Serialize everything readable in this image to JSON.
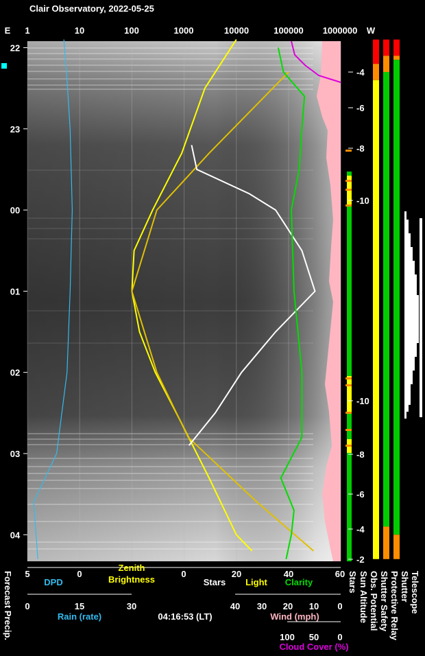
{
  "title": "Clair Observatory, 2022-05-25",
  "timestamp": "04:16:53 (LT)",
  "colors": {
    "background": "#000000",
    "label_white": "#ffffff",
    "dpd": "#33bbee",
    "brightness": "#ffff00",
    "clarity": "#00dd00",
    "wind": "#ffb6c1",
    "cloud": "#dd00dd",
    "red": "#ff0000",
    "orange": "#ff8c00",
    "yellow": "#ffff00",
    "green": "#00cc00",
    "cyan_marker": "#00ffff"
  },
  "top_axis": {
    "left_label": "E",
    "right_label": "W",
    "ticks": [
      "1",
      "10",
      "100",
      "1000",
      "10000",
      "100000",
      "1000000"
    ]
  },
  "time_ticks": [
    "22",
    "23",
    "00",
    "01",
    "02",
    "03",
    "04"
  ],
  "sun_altitude_ticks": [
    "-4",
    "-6",
    "-8",
    "-10",
    "-10",
    "-8",
    "-6",
    "-4",
    "-2"
  ],
  "bottom": {
    "row1_ticks": [
      "5",
      "0",
      "0",
      "20",
      "40",
      "60"
    ],
    "row1_labels": {
      "dpd": "DPD",
      "zenith": "Zenith",
      "brightness": "Brightness",
      "stars": "Stars",
      "light": "Light",
      "clarity": "Clarity"
    },
    "rain_ticks": [
      "0",
      "15",
      "30"
    ],
    "rain_label": "Rain (rate)",
    "wind_ticks": [
      "40",
      "30",
      "20",
      "10",
      "0"
    ],
    "wind_label": "Wind (mph)",
    "cloud_ticks": [
      "100",
      "50",
      "0"
    ],
    "cloud_label": "Cloud Cover (%)"
  },
  "vertical_labels": {
    "forecast": "Forecast Precip.",
    "stars": "Stars",
    "sun_alt": "Sun Altitude",
    "obs_potential": "Obs. Potential",
    "shutter_safety": "Shutter Safety",
    "protective_relay": "Protective Relay",
    "shutter": "Shutter",
    "telescope": "Telescope"
  },
  "chart_data": {
    "type": "line",
    "title": "Clair Observatory, 2022-05-25",
    "x_axis_scale": "log",
    "x_axis_ticks": [
      1,
      10,
      100,
      1000,
      10000,
      100000,
      1000000
    ],
    "y_axis": "local time",
    "y_ticks": [
      "22",
      "23",
      "00",
      "01",
      "02",
      "03",
      "04"
    ],
    "series": [
      {
        "name": "Zenith Brightness",
        "points": [
          [
            21.9,
            10000
          ],
          [
            22.5,
            2500
          ],
          [
            23.3,
            900
          ],
          [
            0.0,
            250
          ],
          [
            0.5,
            110
          ],
          [
            1.0,
            100
          ],
          [
            1.5,
            140
          ],
          [
            2.0,
            280
          ],
          [
            2.6,
            850
          ],
          [
            3.3,
            3000
          ],
          [
            4.0,
            10000
          ],
          [
            4.2,
            20000
          ]
        ]
      },
      {
        "name": "Light",
        "points": [
          [
            22.3,
            100000
          ],
          [
            23.3,
            3000
          ],
          [
            0.0,
            300
          ],
          [
            1.0,
            100
          ],
          [
            2.0,
            300
          ],
          [
            2.8,
            1200
          ],
          [
            3.6,
            25000
          ],
          [
            4.2,
            300000
          ]
        ]
      },
      {
        "name": "Stars",
        "points": [
          [
            23.2,
            3
          ],
          [
            23.5,
            5
          ],
          [
            23.8,
            25
          ],
          [
            0.0,
            35
          ],
          [
            0.5,
            45
          ],
          [
            1.0,
            50
          ],
          [
            1.5,
            35
          ],
          [
            2.0,
            22
          ],
          [
            2.5,
            12
          ],
          [
            2.9,
            2
          ]
        ]
      },
      {
        "name": "Clarity",
        "points": [
          [
            22.0,
            36
          ],
          [
            22.3,
            38
          ],
          [
            22.6,
            46
          ],
          [
            23.0,
            45
          ],
          [
            23.5,
            44
          ],
          [
            0.0,
            41
          ],
          [
            1.0,
            42
          ],
          [
            2.0,
            45
          ],
          [
            2.8,
            45
          ],
          [
            3.3,
            37
          ],
          [
            3.7,
            42
          ],
          [
            4.0,
            41
          ],
          [
            4.3,
            39
          ]
        ]
      },
      {
        "name": "DPD",
        "points": [
          [
            21.9,
            1.5
          ],
          [
            22.4,
            1.2
          ],
          [
            23.0,
            0.9
          ],
          [
            0.0,
            0.7
          ],
          [
            1.0,
            0.9
          ],
          [
            2.0,
            1.2
          ],
          [
            3.0,
            2.2
          ],
          [
            3.6,
            4.4
          ],
          [
            4.3,
            4.0
          ]
        ]
      }
    ],
    "status_bars": {
      "obs_potential": [
        {
          "from": 21.9,
          "to": 22.2,
          "color": "red"
        },
        {
          "from": 22.2,
          "to": 22.4,
          "color": "orange"
        },
        {
          "from": 22.4,
          "to": 4.3,
          "color": "yellow"
        }
      ],
      "shutter_safety": [
        {
          "from": 21.9,
          "to": 22.1,
          "color": "red"
        },
        {
          "from": 22.1,
          "to": 22.3,
          "color": "orange"
        },
        {
          "from": 22.3,
          "to": 3.9,
          "color": "green"
        },
        {
          "from": 3.9,
          "to": 4.3,
          "color": "orange"
        }
      ],
      "protective_relay": [
        {
          "from": 21.9,
          "to": 22.1,
          "color": "red"
        },
        {
          "from": 22.1,
          "to": 22.15,
          "color": "orange"
        },
        {
          "from": 22.15,
          "to": 4.0,
          "color": "green"
        },
        {
          "from": 4.0,
          "to": 4.3,
          "color": "orange"
        }
      ]
    }
  }
}
